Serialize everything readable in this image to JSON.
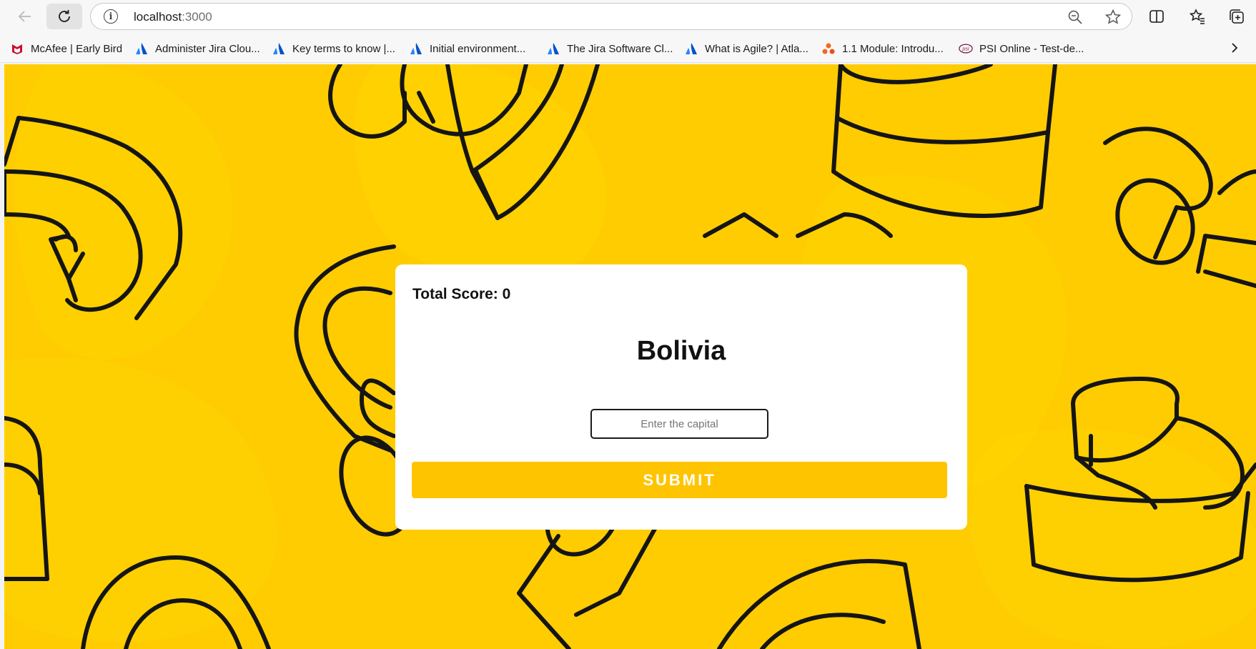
{
  "browser": {
    "url_host": "localhost",
    "url_port": ":3000",
    "bookmarks": [
      {
        "label": "McAfee | Early Bird",
        "icon": "mcafee-icon"
      },
      {
        "label": "Administer Jira Clou...",
        "icon": "atlassian-icon"
      },
      {
        "label": "Key terms to know |...",
        "icon": "atlassian-icon"
      },
      {
        "label": "Initial environment...",
        "icon": "atlassian-icon"
      },
      {
        "label": "The Jira Software Cl...",
        "icon": "atlassian-icon"
      },
      {
        "label": "What is Agile? | Atla...",
        "icon": "atlassian-icon"
      },
      {
        "label": "1.1 Module: Introdu...",
        "icon": "module-icon"
      },
      {
        "label": "PSI Online - Test-de...",
        "icon": "psi-icon"
      }
    ]
  },
  "game": {
    "score_label": "Total Score: 0",
    "country": "Bolivia",
    "input_placeholder": "Enter the capital",
    "input_value": "",
    "submit_label": "SUBMIT"
  },
  "colors": {
    "background": "#ffcc02",
    "submit": "#ffc400",
    "card": "#ffffff"
  }
}
